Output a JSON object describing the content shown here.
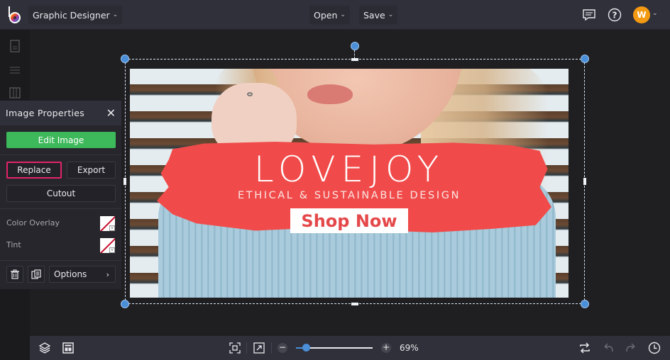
{
  "app": {
    "project_menu_label": "Graphic Designer",
    "open_label": "Open",
    "save_label": "Save",
    "user_initial": "W"
  },
  "colors": {
    "accent_blue": "#4a8fd8",
    "edit_green": "#3db85a",
    "highlight_pink": "#e32468",
    "avatar_orange": "#f39a12",
    "banner_red": "#f04b4a"
  },
  "panel": {
    "title": "Image Properties",
    "edit_image_label": "Edit Image",
    "replace_label": "Replace",
    "export_label": "Export",
    "cutout_label": "Cutout",
    "color_overlay_label": "Color Overlay",
    "tint_label": "Tint",
    "options_label": "Options"
  },
  "design": {
    "title": "LOVEJOY",
    "subtitle": "ETHICAL & SUSTAINABLE DESIGN",
    "cta": "Shop Now"
  },
  "bottombar": {
    "zoom_percent": 69,
    "zoom_label": "69%",
    "zoom_slider_fraction": 0.13
  }
}
